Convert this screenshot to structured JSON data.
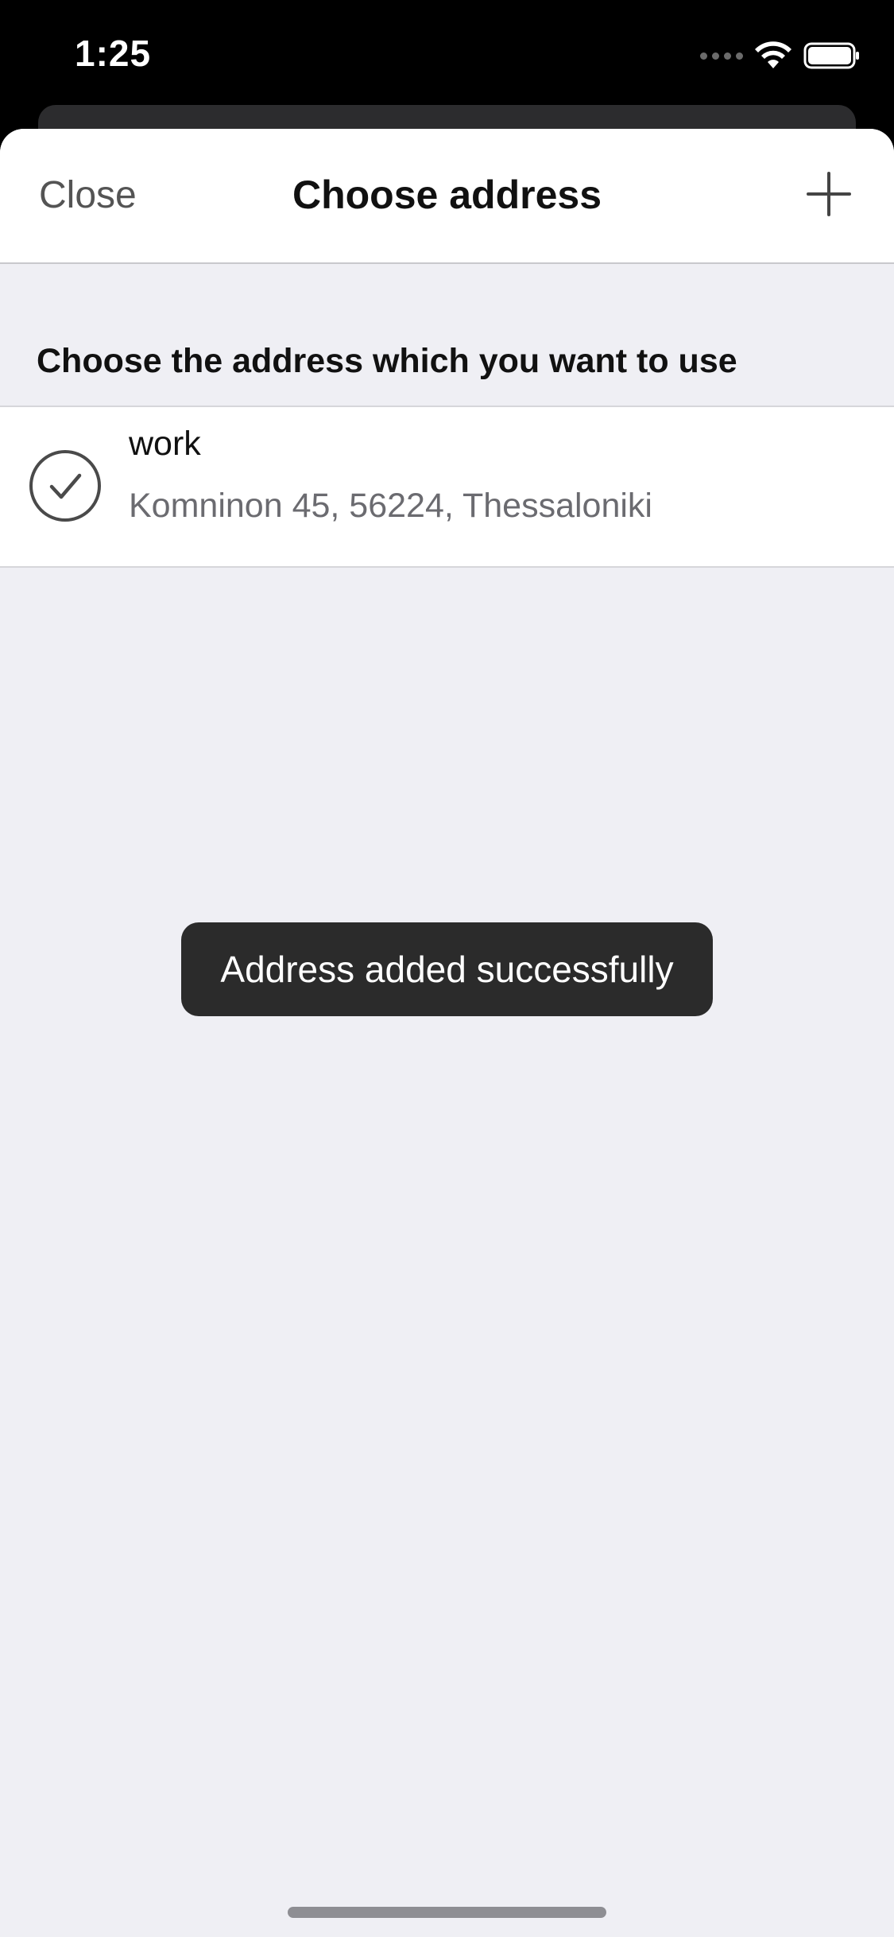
{
  "status_bar": {
    "time": "1:25"
  },
  "nav": {
    "close_label": "Close",
    "title": "Choose address",
    "add_icon": "plus-icon"
  },
  "section": {
    "header": "Choose the address which you want to use"
  },
  "addresses": [
    {
      "name": "work",
      "address": "Komninon 45, 56224, Thessaloniki",
      "selected": true,
      "icon": "check-circle-icon"
    }
  ],
  "toast": {
    "message": "Address added successfully"
  },
  "colors": {
    "sheet_background": "#efeff4",
    "toast_background": "#2b2b2b",
    "secondary_text": "#6b6b70"
  }
}
